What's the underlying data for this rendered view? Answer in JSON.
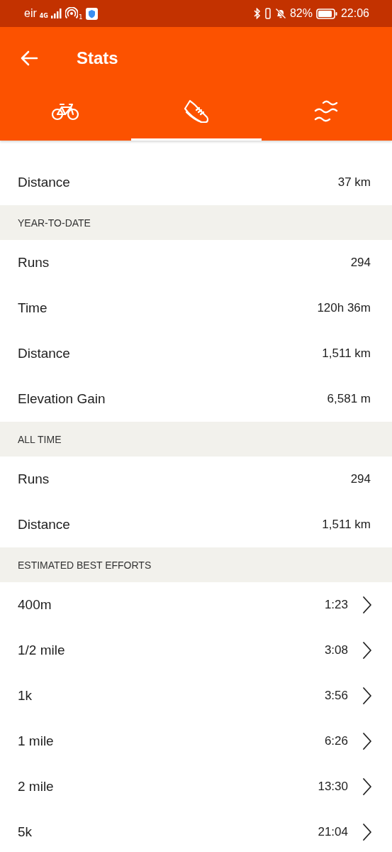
{
  "status_bar": {
    "carrier": "eir",
    "network": "4G",
    "hotspot_count": "1",
    "battery": "82%",
    "time": "22:06"
  },
  "header": {
    "title": "Stats"
  },
  "tabs": [
    {
      "kind": "ride",
      "selected": false
    },
    {
      "kind": "run",
      "selected": true
    },
    {
      "kind": "swim",
      "selected": false
    }
  ],
  "sections": [
    {
      "rows": [
        {
          "label": "Distance",
          "value": "37 km",
          "link": false
        }
      ]
    },
    {
      "title": "YEAR-TO-DATE",
      "rows": [
        {
          "label": "Runs",
          "value": "294",
          "link": false
        },
        {
          "label": "Time",
          "value": "120h 36m",
          "link": false
        },
        {
          "label": "Distance",
          "value": "1,511 km",
          "link": false
        },
        {
          "label": "Elevation Gain",
          "value": "6,581 m",
          "link": false
        }
      ]
    },
    {
      "title": "ALL TIME",
      "rows": [
        {
          "label": "Runs",
          "value": "294",
          "link": false
        },
        {
          "label": "Distance",
          "value": "1,511 km",
          "link": false
        }
      ]
    },
    {
      "title": "ESTIMATED BEST EFFORTS",
      "rows": [
        {
          "label": "400m",
          "value": "1:23",
          "link": true
        },
        {
          "label": "1/2 mile",
          "value": "3:08",
          "link": true
        },
        {
          "label": "1k",
          "value": "3:56",
          "link": true
        },
        {
          "label": "1 mile",
          "value": "6:26",
          "link": true
        },
        {
          "label": "2 mile",
          "value": "13:30",
          "link": true
        },
        {
          "label": "5k",
          "value": "21:04",
          "link": true
        }
      ]
    }
  ]
}
